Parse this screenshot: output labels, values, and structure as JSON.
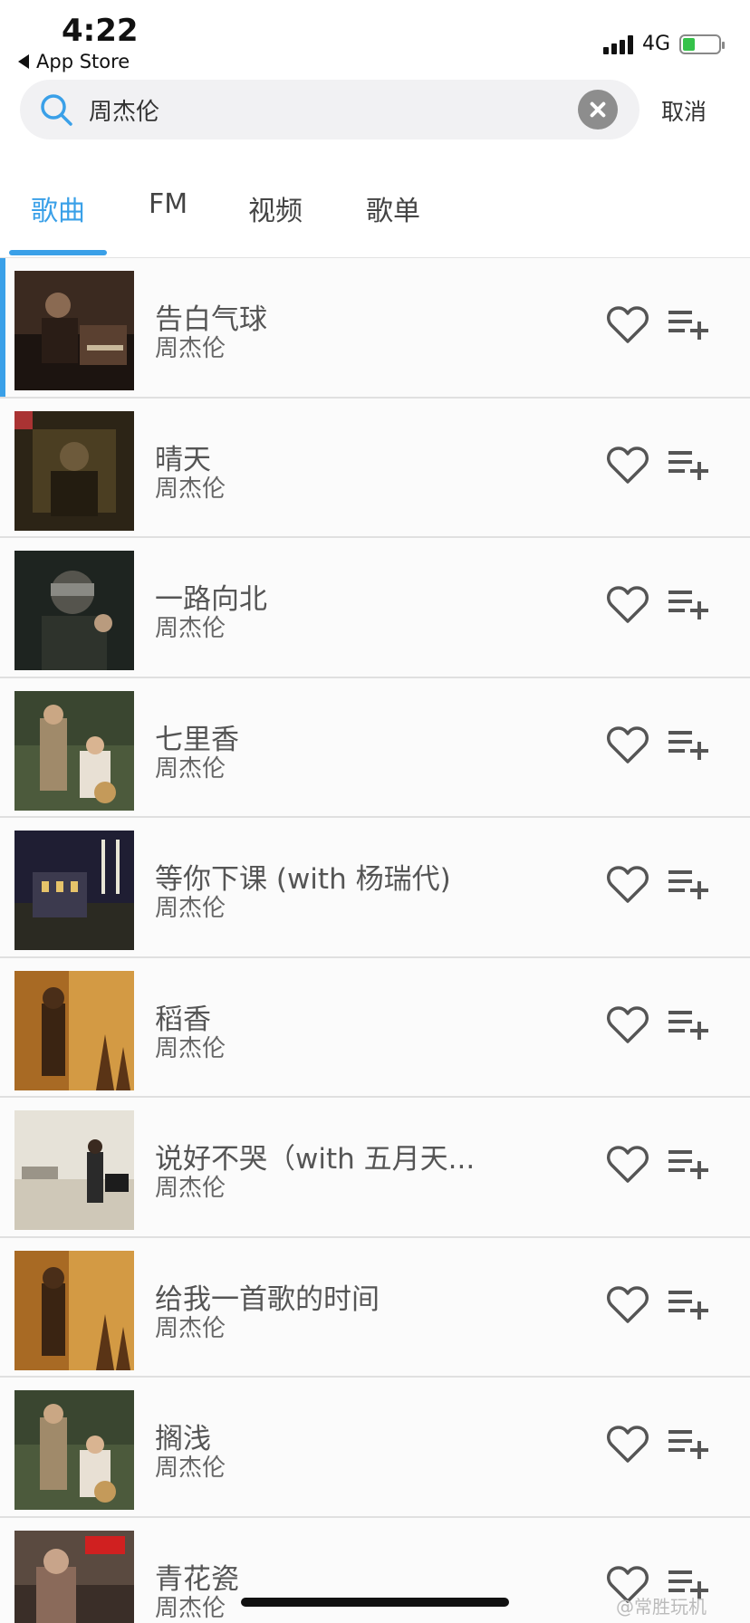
{
  "status": {
    "time": "4:22",
    "back_app": "App Store",
    "network": "4G"
  },
  "search": {
    "query": "周杰伦",
    "cancel_label": "取消"
  },
  "tabs": [
    {
      "label": "歌曲",
      "active": true
    },
    {
      "label": "FM",
      "active": false
    },
    {
      "label": "视频",
      "active": false
    },
    {
      "label": "歌单",
      "active": false
    }
  ],
  "songs": [
    {
      "title": "告白气球",
      "artist": "周杰伦"
    },
    {
      "title": "晴天",
      "artist": "周杰伦"
    },
    {
      "title": "一路向北",
      "artist": "周杰伦"
    },
    {
      "title": "七里香",
      "artist": "周杰伦"
    },
    {
      "title": "等你下课 (with 杨瑞代)",
      "artist": "周杰伦"
    },
    {
      "title": "稻香",
      "artist": "周杰伦"
    },
    {
      "title": "说好不哭（with 五月天...",
      "artist": "周杰伦"
    },
    {
      "title": "给我一首歌的时间",
      "artist": "周杰伦"
    },
    {
      "title": "搁浅",
      "artist": "周杰伦"
    },
    {
      "title": "青花瓷",
      "artist": "周杰伦"
    }
  ],
  "watermark": "@常胜玩机",
  "colors": {
    "accent": "#3aa0e8",
    "icon": "#555555",
    "divider": "#e0e0e0"
  }
}
